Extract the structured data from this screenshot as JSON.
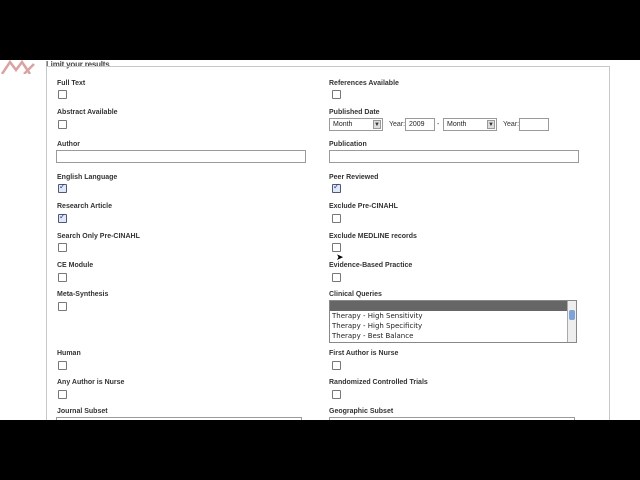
{
  "header": {
    "section_title": "Limit your results",
    "logo_icon": "brand-logo-icon"
  },
  "left": {
    "full_text": {
      "label": "Full Text",
      "checked": false
    },
    "abstract": {
      "label": "Abstract Available",
      "checked": false
    },
    "author": {
      "label": "Author",
      "value": ""
    },
    "english": {
      "label": "English Language",
      "checked": true
    },
    "research": {
      "label": "Research Article",
      "checked": true
    },
    "pre_cinahl": {
      "label": "Search Only Pre-CINAHL",
      "checked": false
    },
    "ce_module": {
      "label": "CE Module",
      "checked": false
    },
    "meta_synthesis": {
      "label": "Meta-Synthesis",
      "checked": false
    },
    "human": {
      "label": "Human",
      "checked": false
    },
    "any_author_nurse": {
      "label": "Any Author is Nurse",
      "checked": false
    },
    "journal_subset": {
      "label": "Journal Subset"
    }
  },
  "right": {
    "references": {
      "label": "References Available",
      "checked": false
    },
    "published_date": {
      "label": "Published Date",
      "from_month": "Month",
      "year_label": "Year:",
      "from_year": "2009",
      "dash": "-",
      "to_month": "Month",
      "to_year_label": "Year:",
      "to_year": ""
    },
    "publication": {
      "label": "Publication",
      "value": ""
    },
    "peer_reviewed": {
      "label": "Peer Reviewed",
      "checked": true
    },
    "exclude_pre_cinahl": {
      "label": "Exclude Pre-CINAHL",
      "checked": false
    },
    "exclude_medline": {
      "label": "Exclude MEDLINE records",
      "checked": false
    },
    "evidence_based": {
      "label": "Evidence-Based Practice",
      "checked": false
    },
    "clinical_queries": {
      "label": "Clinical Queries",
      "options": [
        "",
        "Therapy - High Sensitivity",
        "Therapy - High Specificity",
        "Therapy - Best Balance"
      ]
    },
    "first_author_nurse": {
      "label": "First Author is Nurse",
      "checked": false
    },
    "rct": {
      "label": "Randomized Controlled Trials",
      "checked": false
    },
    "geographic_subset": {
      "label": "Geographic Subset"
    }
  }
}
